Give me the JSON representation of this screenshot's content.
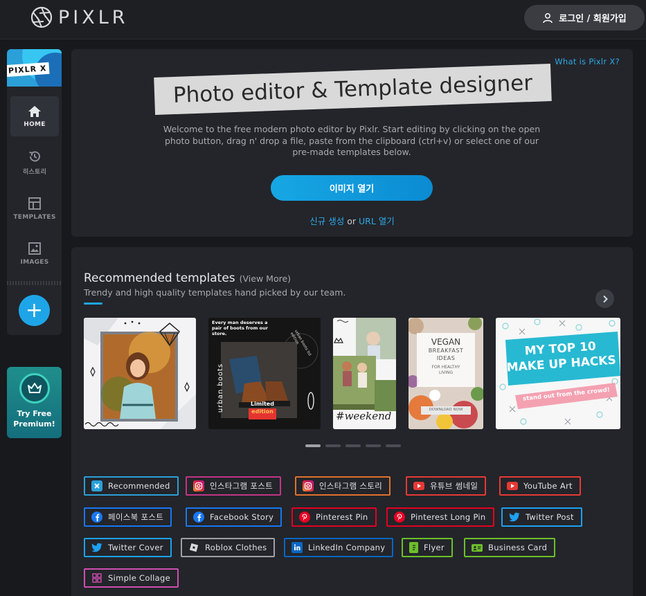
{
  "header": {
    "logo_text": "PIXLR",
    "login_label": "로그인 / 회원가입"
  },
  "sidebar": {
    "banner_tag": "PIXLR X",
    "items": [
      {
        "label": "HOME",
        "icon": "home-icon",
        "active": true
      },
      {
        "label": "히스토리",
        "icon": "history-icon",
        "active": false
      },
      {
        "label": "TEMPLATES",
        "icon": "templates-icon",
        "active": false
      },
      {
        "label": "IMAGES",
        "icon": "image-icon",
        "active": false
      }
    ],
    "add_label": "+",
    "premium_label": "Try Free Premium!"
  },
  "hero": {
    "what_is_link": "What is Pixlr X?",
    "title": "Photo editor & Template designer",
    "description": "Welcome to the free modern photo editor by Pixlr. Start editing by clicking on the open photo button, drag n' drop a file, paste from the clipboard (ctrl+v) or select one of our pre-made templates below.",
    "open_button": "이미지 열기",
    "new_link": "신규 생성",
    "or_text": "or",
    "url_link": "URL 열기"
  },
  "templates": {
    "title": "Recommended templates",
    "view_more": "(View More)",
    "subtitle": "Trendy and high quality templates hand picked by our team.",
    "thumbs": [
      {
        "name": "girl-portrait-template"
      },
      {
        "name": "urban-boots-template",
        "headline": "Every man deserves a pair of boots from our store.",
        "brand": "urban boots",
        "ring_text": "urban boots ltd edition",
        "badge_line1": "Limited",
        "badge_line2": "edition"
      },
      {
        "name": "weekend-template",
        "script": "#weekend"
      },
      {
        "name": "vegan-breakfast-template",
        "line1": "VEGAN",
        "line2": "BREAKFAST",
        "line3": "IDEAS",
        "line4": "FOR HEALTHY",
        "line5": "LIVING",
        "cta": "DOWNLOAD NOW"
      },
      {
        "name": "make-up-hacks-template",
        "line1": "MY TOP 10",
        "line2": "MAKE UP HACKS",
        "ribbon": "stand out from the crowd!"
      }
    ],
    "pager_count": 5,
    "pager_active": 0
  },
  "categories": [
    {
      "label": "Recommended",
      "icon": "pixlr-x-icon",
      "color": "#2b9fd8"
    },
    {
      "label": "인스타그램 포스트",
      "icon": "instagram-icon",
      "color": "#c13584"
    },
    {
      "label": "인스타그램 스토리",
      "icon": "instagram-icon",
      "color": "#e1712b"
    },
    {
      "label": "유튜브 썸네일",
      "icon": "youtube-icon",
      "color": "#e53935"
    },
    {
      "label": "YouTube Art",
      "icon": "youtube-icon",
      "color": "#e53935"
    },
    {
      "label": "페이스북 포스트",
      "icon": "facebook-icon",
      "color": "#1877f2"
    },
    {
      "label": "Facebook Story",
      "icon": "facebook-icon",
      "color": "#1877f2"
    },
    {
      "label": "Pinterest Pin",
      "icon": "pinterest-icon",
      "color": "#e60023"
    },
    {
      "label": "Pinterest Long Pin",
      "icon": "pinterest-icon",
      "color": "#e60023"
    },
    {
      "label": "Twitter Post",
      "icon": "twitter-icon",
      "color": "#1da1f2"
    },
    {
      "label": "Twitter Cover",
      "icon": "twitter-icon",
      "color": "#1da1f2"
    },
    {
      "label": "Roblox Clothes",
      "icon": "roblox-icon",
      "color": "#9ea1a6"
    },
    {
      "label": "LinkedIn Company",
      "icon": "linkedin-icon",
      "color": "#0a66c2"
    },
    {
      "label": "Flyer",
      "icon": "flyer-icon",
      "color": "#6cbf2a"
    },
    {
      "label": "Business Card",
      "icon": "business-card-icon",
      "color": "#6cbf2a"
    },
    {
      "label": "Simple Collage",
      "icon": "collage-icon",
      "color": "#d04db0"
    }
  ]
}
